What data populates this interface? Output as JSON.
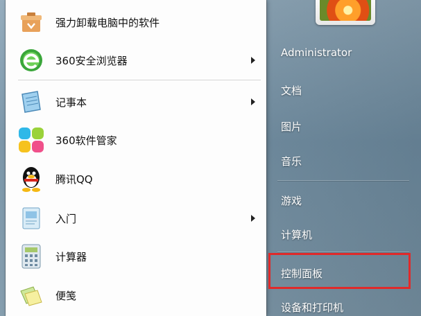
{
  "programs": [
    {
      "label": "强力卸载电脑中的软件",
      "icon": "uninstall-box-icon",
      "has_submenu": false
    },
    {
      "label": "360安全浏览器",
      "icon": "360-browser-icon",
      "has_submenu": true
    },
    {
      "label": "记事本",
      "icon": "notepad-icon",
      "has_submenu": true
    },
    {
      "label": "360软件管家",
      "icon": "360-software-manager-icon",
      "has_submenu": false
    },
    {
      "label": "腾讯QQ",
      "icon": "qq-penguin-icon",
      "has_submenu": false
    },
    {
      "label": "入门",
      "icon": "getting-started-icon",
      "has_submenu": true
    },
    {
      "label": "计算器",
      "icon": "calculator-icon",
      "has_submenu": false
    },
    {
      "label": "便笺",
      "icon": "sticky-notes-icon",
      "has_submenu": false
    }
  ],
  "right": {
    "username": "Administrator",
    "links": [
      "文档",
      "图片",
      "音乐",
      "游戏",
      "计算机",
      "控制面板",
      "设备和打印机"
    ],
    "highlighted": "控制面板"
  },
  "colors": {
    "highlight_border": "#e02a2a",
    "menu_bg": "#fdfdfd"
  }
}
